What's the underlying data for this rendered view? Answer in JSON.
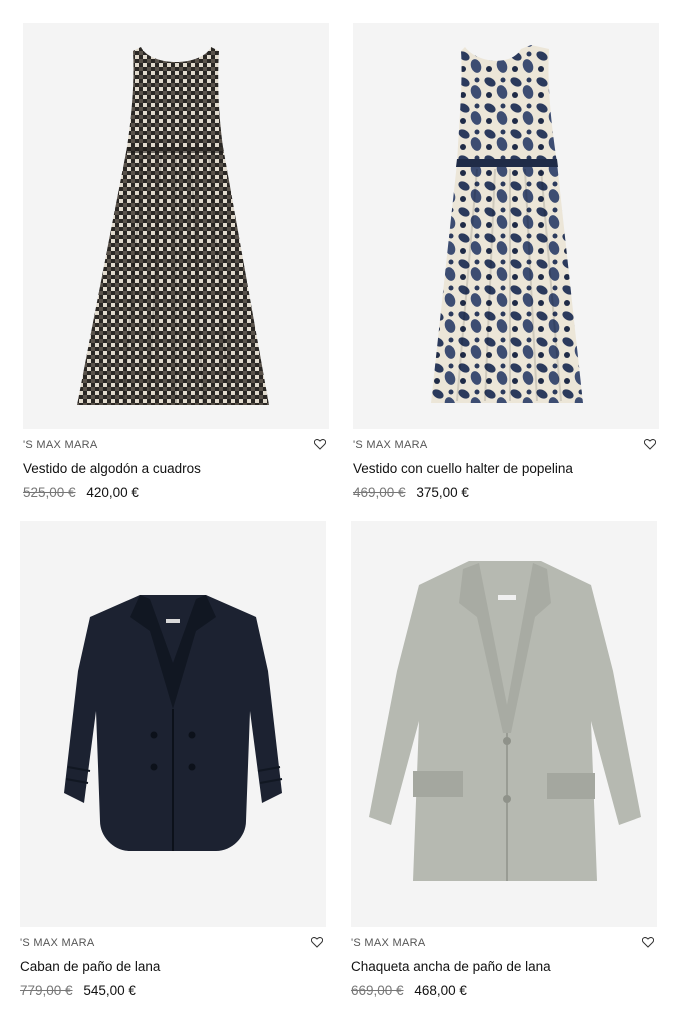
{
  "products": [
    {
      "brand": "'S MAX MARA",
      "name": "Vestido de algodón a cuadros",
      "original_price": "525,00 €",
      "sale_price": "420,00 €",
      "image_icon": "checked-sleeveless-dress-image",
      "colors": {
        "primary": "#2a2724",
        "secondary": "#d9d3c8"
      }
    },
    {
      "brand": "'S MAX MARA",
      "name": "Vestido con cuello halter de popelina",
      "original_price": "469,00 €",
      "sale_price": "375,00 €",
      "image_icon": "floral-halter-dress-image",
      "colors": {
        "primary": "#2b3a5c",
        "secondary": "#ece6d8"
      }
    },
    {
      "brand": "'S MAX MARA",
      "name": "Caban de paño de lana",
      "original_price": "779,00 €",
      "sale_price": "545,00 €",
      "image_icon": "navy-pea-coat-image",
      "colors": {
        "primary": "#1c2231",
        "secondary": "#111722"
      }
    },
    {
      "brand": "'S MAX MARA",
      "name": "Chaqueta ancha de paño de lana",
      "original_price": "669,00 €",
      "sale_price": "468,00 €",
      "image_icon": "grey-wool-jacket-image",
      "colors": {
        "primary": "#b6b9b1",
        "secondary": "#9ea198"
      }
    }
  ],
  "wishlist_icon": "heart-outline-icon",
  "image_background": "#f4f4f4"
}
